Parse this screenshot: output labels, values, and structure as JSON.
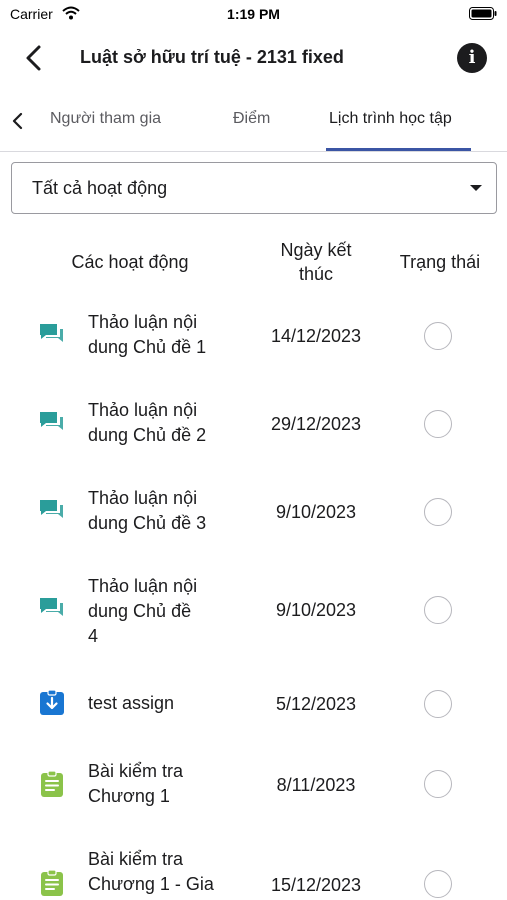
{
  "status_bar": {
    "carrier": "Carrier",
    "time": "1:19 PM"
  },
  "nav": {
    "title": "Luật sở hữu trí tuệ - 2131 fixed"
  },
  "tabs": [
    {
      "label": "Người tham gia"
    },
    {
      "label": "Điểm"
    },
    {
      "label": "Lịch trình học tập",
      "active": true
    }
  ],
  "filter": {
    "value": "Tất cả hoạt động"
  },
  "table": {
    "headers": {
      "activity": "Các hoạt động",
      "due_line1": "Ngày kết",
      "due_line2": "thúc",
      "status": "Trạng thái"
    },
    "rows": [
      {
        "icon": "forum-icon",
        "line1": "Thảo luận nội",
        "line2": "dung Chủ đề 1",
        "line3": "",
        "date": "14/12/2023",
        "completed": false
      },
      {
        "icon": "forum-icon",
        "line1": "Thảo luận nội",
        "line2": "dung Chủ đề 2",
        "line3": "",
        "date": "29/12/2023",
        "completed": false
      },
      {
        "icon": "forum-icon",
        "line1": "Thảo luận nội",
        "line2": "dung Chủ đề 3",
        "line3": "",
        "date": "9/10/2023",
        "completed": false
      },
      {
        "icon": "forum-icon",
        "line1": "Thảo luận nội",
        "line2": "dung Chủ đề",
        "line3": "4",
        "date": "9/10/2023",
        "completed": false
      },
      {
        "icon": "assignment-icon",
        "line1": "test assign",
        "line2": "",
        "line3": "",
        "date": "5/12/2023",
        "completed": false
      },
      {
        "icon": "quiz-icon",
        "line1": "Bài kiểm tra",
        "line2": "Chương 1",
        "line3": "",
        "date": "8/11/2023",
        "completed": false
      },
      {
        "icon": "quiz-icon",
        "line1": "Bài kiểm tra",
        "line2": "Chương 1 - Gia",
        "line3": "",
        "date": "15/12/2023",
        "completed": false
      }
    ]
  },
  "colors": {
    "accent": "#3b55a4",
    "forum_icon": "#2a9d9a",
    "assignment_icon": "#1976d2",
    "quiz_icon": "#8bc34a"
  }
}
